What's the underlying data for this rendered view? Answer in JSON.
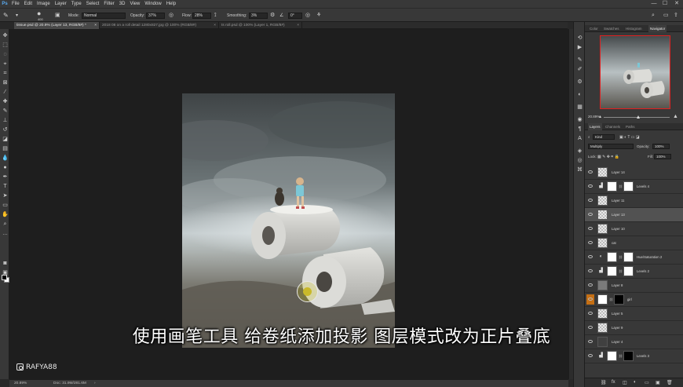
{
  "menu": [
    "File",
    "Edit",
    "Image",
    "Layer",
    "Type",
    "Select",
    "Filter",
    "3D",
    "View",
    "Window",
    "Help"
  ],
  "window_controls": {
    "minimize": "—",
    "maximize": "☐",
    "close": "✕"
  },
  "options": {
    "brush_size": "400",
    "mode_label": "Mode:",
    "mode_value": "Normal",
    "opacity_label": "Opacity:",
    "opacity_value": "37%",
    "flow_label": "Flow:",
    "flow_value": "28%",
    "smoothing_label": "Smoothing:",
    "smoothing_value": "3%",
    "angle_value": "0°"
  },
  "tabs": [
    {
      "label": "tissue.psd @ 20.9% (Layer 13, RGB/8#) *",
      "close": "×"
    },
    {
      "label": "2018 08 on a roll detail 1280x827.jpg @ 100% (RGB/8#)",
      "close": "×"
    },
    {
      "label": "ts roll.psd @ 100% (Layer 1, RGB/8#)",
      "close": "×"
    }
  ],
  "status": {
    "zoom": "20.89%",
    "doc": "Doc: 31.9M/281.6M"
  },
  "subtitle": "使用画笔工具 给卷纸添加投影 图层模式改为正片叠底",
  "watermark": "RAFYA88",
  "top_panel_tabs": [
    "Color",
    "Swatches",
    "Histogram",
    "Navigator"
  ],
  "navigator": {
    "zoom": "20.89%"
  },
  "layers_panel_tabs": [
    "Layers",
    "Channels",
    "Paths"
  ],
  "layers_ctrl": {
    "kind": "Kind",
    "blend": "Multiply",
    "opacity_label": "Opacity:",
    "opacity_value": "100%",
    "lock_label": "Lock:",
    "fill_label": "Fill:",
    "fill_value": "100%"
  },
  "layers": [
    {
      "name": "Layer 14",
      "thumb": "checker",
      "mask": "",
      "selected": false,
      "adj": ""
    },
    {
      "name": "Levels 4",
      "thumb": "white",
      "mask": "white",
      "selected": false,
      "adj": "▟"
    },
    {
      "name": "Layer 11",
      "thumb": "checker",
      "mask": "",
      "selected": false,
      "adj": ""
    },
    {
      "name": "Layer 13",
      "thumb": "checker",
      "mask": "",
      "selected": true,
      "adj": ""
    },
    {
      "name": "Layer 10",
      "thumb": "checker",
      "mask": "",
      "selected": false,
      "adj": ""
    },
    {
      "name": "cat",
      "thumb": "checker",
      "mask": "",
      "selected": false,
      "adj": ""
    },
    {
      "name": "Hue/Saturation 2",
      "thumb": "white",
      "mask": "white",
      "selected": false,
      "adj": "◐"
    },
    {
      "name": "Levels 2",
      "thumb": "white",
      "mask": "white",
      "selected": false,
      "adj": "▟"
    },
    {
      "name": "Layer 8",
      "thumb": "gray",
      "mask": "",
      "selected": false,
      "adj": ""
    },
    {
      "name": "girl",
      "thumb": "white",
      "mask": "black",
      "selected": false,
      "adj": "",
      "orange": true
    },
    {
      "name": "Layer 5",
      "thumb": "checker",
      "mask": "",
      "selected": false,
      "adj": ""
    },
    {
      "name": "Layer 9",
      "thumb": "checker",
      "mask": "",
      "selected": false,
      "adj": ""
    },
    {
      "name": "Layer 4",
      "thumb": "dark",
      "mask": "",
      "selected": false,
      "adj": ""
    },
    {
      "name": "Levels 3",
      "thumb": "white",
      "mask": "black",
      "selected": false,
      "adj": "▟"
    }
  ],
  "footer_icons": [
    "⛓",
    "fx",
    "◫",
    "◐",
    "▭",
    "▣",
    "🗑"
  ]
}
